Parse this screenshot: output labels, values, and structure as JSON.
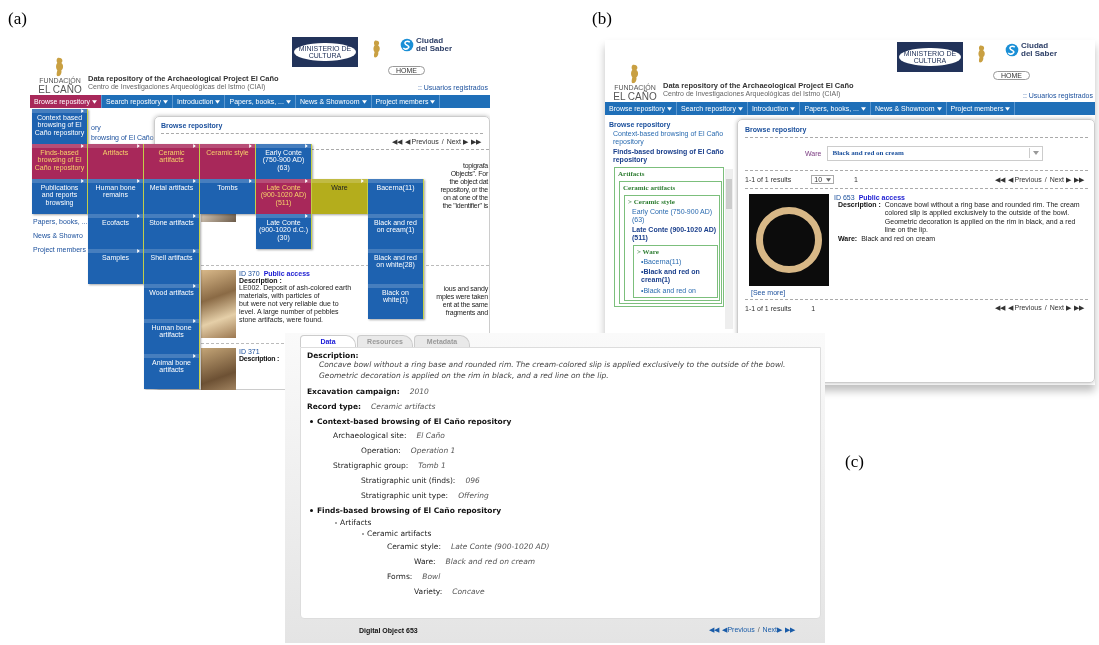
{
  "panel_a": {
    "label": "(a)",
    "header": {
      "logo_lines": [
        "FUNDACIÓN",
        "EL CAÑO"
      ],
      "title": "Data repository of the Archaeological Project El Caño",
      "subtitle": "Centro de Investigaciones Arqueológicas del Istmo (CIAI)",
      "ministry_logo": "MINISTERIO DE CULTURA",
      "ciudad_logo": [
        "Ciudad",
        "del Saber"
      ],
      "home_button": "HOME",
      "user_link": ":: Usuarios registrados"
    },
    "menu_bar": [
      {
        "label": "Browse repository",
        "selected": true
      },
      {
        "label": "Search repository",
        "selected": false
      },
      {
        "label": "Introduction",
        "selected": false
      },
      {
        "label": "Papers, books, ...",
        "selected": false
      },
      {
        "label": "News & Showroom",
        "selected": false
      },
      {
        "label": "Project members",
        "selected": false
      }
    ],
    "sidebar_fragments": [
      "ory",
      "browsing of El Caño"
    ],
    "sidebar": [
      "Papers, books, ...",
      "News & Showro",
      "Project members"
    ],
    "content_title": "Browse repository",
    "pager": {
      "first": "◀◀",
      "prev": "◀ Previous",
      "sep": "/",
      "next": "Next ▶",
      "last": "▶▶"
    },
    "right_fragments": [
      "topigrafa",
      "Objects\". For",
      "the object dat",
      "repository, or the",
      "on at one of the",
      "the \"identifier\" is"
    ],
    "result": {
      "id": "ID 370",
      "access": "Public access",
      "desc_label": "Description :",
      "desc_left": [
        "LE002. Deposit of ash-colored earth",
        "materials, with particles of",
        "but were not very reliable due to",
        "level. A large number of pebbles",
        "stone artifacts, were found."
      ],
      "desc_right": [
        "ious and sandy",
        "mples were taken",
        "ent at the same",
        "fragments and"
      ]
    },
    "result_2": {
      "id": "ID 371",
      "desc_label": "Description :"
    },
    "cascade": [
      [
        {
          "label": "Context based browsing of El Caño repository",
          "selected": false,
          "hovered": false,
          "has_submenu": true
        },
        {
          "label": "Finds-based browsing of El Caño repository",
          "selected": true,
          "hovered": false,
          "has_submenu": true
        },
        {
          "label": "Publications and reports browsing",
          "selected": false,
          "hovered": false,
          "has_submenu": true
        }
      ],
      [
        {
          "label": "Artifacts",
          "selected": true,
          "hovered": false,
          "has_submenu": true
        },
        {
          "label": "Human bone remains",
          "selected": false,
          "hovered": false,
          "has_submenu": true
        },
        {
          "label": "Ecofacts",
          "selected": false,
          "hovered": false,
          "has_submenu": true
        },
        {
          "label": "Samples",
          "selected": false,
          "hovered": false,
          "has_submenu": true
        }
      ],
      [
        {
          "label": "Ceramic artifacts",
          "selected": true,
          "hovered": false,
          "has_submenu": true
        },
        {
          "label": "Metal artifacts",
          "selected": false,
          "hovered": false,
          "has_submenu": true
        },
        {
          "label": "Stone artifacts",
          "selected": false,
          "hovered": false,
          "has_submenu": true
        },
        {
          "label": "Shell artifacts",
          "selected": false,
          "hovered": false,
          "has_submenu": true
        },
        {
          "label": "Wood artifacts",
          "selected": false,
          "hovered": false,
          "has_submenu": true
        },
        {
          "label": "Human bone artifacts",
          "selected": false,
          "hovered": false,
          "has_submenu": true
        },
        {
          "label": "Animal bone artifacts",
          "selected": false,
          "hovered": false,
          "has_submenu": true
        }
      ],
      [
        {
          "label": "Ceramic style",
          "selected": true,
          "hovered": false,
          "has_submenu": true
        },
        {
          "label": "Tombs",
          "selected": false,
          "hovered": false,
          "has_submenu": true
        }
      ],
      [
        {
          "label": "Early Conte (750-900 AD)(63)",
          "selected": false,
          "hovered": false,
          "has_submenu": true
        },
        {
          "label": "Late Conte (900-1020 AD)(511)",
          "selected": true,
          "hovered": false,
          "has_submenu": true
        },
        {
          "label": "Late Conte (900-1020 d.C.)(30)",
          "selected": false,
          "hovered": false,
          "has_submenu": true
        }
      ],
      [
        {
          "label": "Ware",
          "selected": false,
          "hovered": true,
          "has_submenu": true
        }
      ],
      [
        {
          "label": "Bacerna(11)",
          "selected": false,
          "hovered": false,
          "has_submenu": false
        },
        {
          "label": "Black and red on cream(1)",
          "selected": false,
          "hovered": false,
          "has_submenu": false
        },
        {
          "label": "Black and red on white(28)",
          "selected": false,
          "hovered": false,
          "has_submenu": false
        },
        {
          "label": "Black on white(1)",
          "selected": false,
          "hovered": false,
          "has_submenu": false
        }
      ]
    ]
  },
  "panel_b": {
    "label": "(b)",
    "header": {
      "logo_lines": [
        "FUNDACIÓN",
        "EL CAÑO"
      ],
      "title": "Data repository of the Archaeological Project El Caño",
      "subtitle": "Centro de Investigaciones Arqueológicas del Istmo (CIAI)",
      "ministry_logo": "MINISTERIO DE CULTURA",
      "ciudad_logo": [
        "Ciudad",
        "del Saber"
      ],
      "home_button": "HOME",
      "user_link": ":: Usuarios registrados"
    },
    "menu_bar": [
      {
        "label": "Browse repository",
        "selected": false
      },
      {
        "label": "Search repository",
        "selected": false
      },
      {
        "label": "Introduction",
        "selected": false
      },
      {
        "label": "Papers, books, ...",
        "selected": false
      },
      {
        "label": "News & Showroom",
        "selected": false
      },
      {
        "label": "Project members",
        "selected": false
      }
    ],
    "sidebar": {
      "title": "Browse repository",
      "items": [
        {
          "kind": "link",
          "label": "Context-based browsing of El Caño repository",
          "selected": false
        },
        {
          "kind": "link",
          "label": "Finds-based browsing of El Caño repository",
          "selected": true,
          "children": [
            {
              "kind": "group",
              "label": "Artifacts",
              "children": [
                {
                  "kind": "group",
                  "label": "Ceramic artifacts",
                  "children": [
                    {
                      "kind": "group",
                      "label": "> Ceramic style",
                      "children": [
                        {
                          "kind": "link",
                          "label": "Early Conte (750-900 AD)(63)",
                          "selected": false
                        },
                        {
                          "kind": "link",
                          "label": "Late Conte (900-1020 AD)(511)",
                          "selected": true,
                          "children": [
                            {
                              "kind": "group",
                              "label": "> Ware",
                              "children": [
                                {
                                  "kind": "link",
                                  "label": "•Bacerna(11)",
                                  "selected": false
                                },
                                {
                                  "kind": "link",
                                  "label": "•Black and red on cream(1)",
                                  "selected": true
                                },
                                {
                                  "kind": "link",
                                  "label": "•Black and red on",
                                  "selected": false
                                }
                              ]
                            }
                          ]
                        }
                      ]
                    }
                  ]
                }
              ]
            }
          ]
        }
      ]
    },
    "content_title": "Browse repository",
    "filter": {
      "label": "Ware",
      "value": "Black and red on cream"
    },
    "results_count": "1-1 of 1 results",
    "page_size": "10",
    "page": "1",
    "pager": {
      "first": "◀◀",
      "prev": "◀ Previous",
      "sep": "/",
      "next": "Next ▶",
      "last": "▶▶"
    },
    "result": {
      "id": "ID 653",
      "access": "Public access",
      "desc_label": "Description :",
      "description": "Concave bowl without a ring base and rounded rim. The cream colored slip is applied exclusively to the outside of the bowl. Geometric decoration is applied on the rim in black, and a red line on the lip.",
      "ware_label": "Ware:",
      "ware": "Black and red on cream",
      "see_more": "[See more]"
    },
    "bottom_count": "1-1 of 1 results",
    "bottom_page": "1",
    "bottom_pager": {
      "first": "◀◀",
      "prev": "◀ Previous",
      "sep": "/",
      "next": "Next ▶",
      "last": "▶▶"
    }
  },
  "panel_c": {
    "label": "(c)",
    "tabs": [
      {
        "label": "Data",
        "selected": true
      },
      {
        "label": "Resources",
        "selected": false
      },
      {
        "label": "Metadata",
        "selected": false
      }
    ],
    "description_label": "Description:",
    "description": "Concave bowl without a ring base and rounded rim. The cream-colored slip is applied exclusively to the outside of the bowl. Geometric decoration is applied on the rim in black, and a red line on the lip.",
    "fields": [
      {
        "label": "Excavation campaign:",
        "value": "2010"
      },
      {
        "label": "Record type:",
        "value": "Ceramic artifacts"
      }
    ],
    "context_section": {
      "title": "Context-based browsing of El Caño repository",
      "fields": [
        {
          "label": "Archaeological site:",
          "value": "El Caño",
          "children": [
            {
              "label": "Operation:",
              "value": "Operation 1"
            }
          ]
        },
        {
          "label": "Stratigraphic group:",
          "value": "Tomb 1",
          "children": [
            {
              "label": "Stratigraphic unit (finds):",
              "value": "096"
            },
            {
              "label": "Stratigraphic unit type:",
              "value": "Offering"
            }
          ]
        }
      ]
    },
    "finds_section": {
      "title": "Finds-based browsing of El Caño repository",
      "category": "Artifacts",
      "subcategory": "Ceramic artifacts",
      "fields": [
        {
          "label": "Ceramic style:",
          "value": "Late Conte (900-1020 AD)",
          "children": [
            {
              "label": "Ware:",
              "value": "Black and red on cream"
            }
          ]
        },
        {
          "label": "Forms:",
          "value": "Bowl",
          "children": [
            {
              "label": "Variety:",
              "value": "Concave"
            }
          ]
        }
      ]
    },
    "footer": "Digital Object 653",
    "pager": {
      "first": "◀◀",
      "prev": "◀Previous",
      "sep": "/",
      "next": "Next▶",
      "last": "▶▶"
    }
  }
}
